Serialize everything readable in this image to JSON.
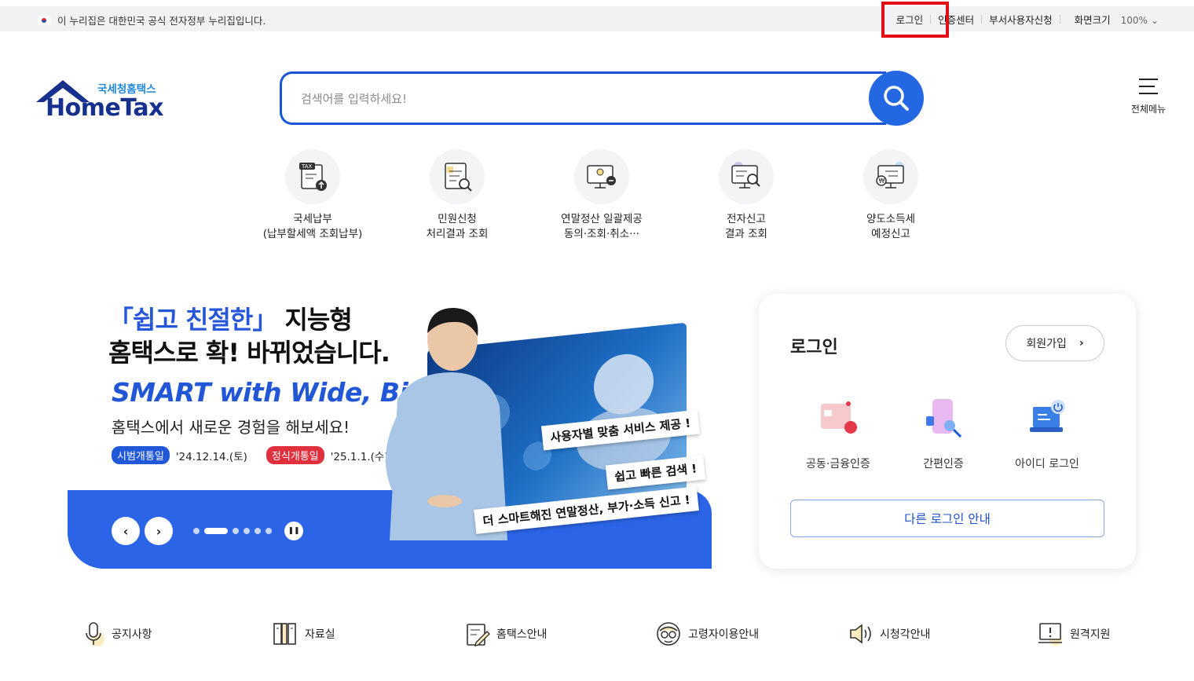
{
  "topbar": {
    "gov_notice": "이 누리집은 대한민국 공식 전자정부 누리집입니다.",
    "links": [
      "로그인",
      "인증센터",
      "부서사용자신청",
      "화면크기"
    ],
    "zoom": "100%"
  },
  "logo": {
    "sub": "국세청홈택스",
    "main": "HomeTax"
  },
  "search": {
    "placeholder": "검색어를 입력하세요!"
  },
  "menu_all": "전체메뉴",
  "quick_menu": [
    {
      "line1": "국세납부",
      "line2": "(납부할세액 조회납부)",
      "icon": "tax-payment-icon"
    },
    {
      "line1": "민원신청",
      "line2": "처리결과 조회",
      "icon": "document-search-icon"
    },
    {
      "line1": "연말정산 일괄제공",
      "line2": "동의·조회·취소···",
      "icon": "monitor-location-icon"
    },
    {
      "line1": "전자신고",
      "line2": "결과 조회",
      "icon": "monitor-search-icon"
    },
    {
      "line1": "양도소득세",
      "line2": "예정신고",
      "icon": "monitor-won-icon"
    }
  ],
  "banner": {
    "headline1_hl": "「쉽고 친절한」",
    "headline1_rest": " 지능형",
    "headline2": "홈택스로 확! 바뀌었습니다.",
    "smart": "SMART with Wide, Big",
    "desc": "홈택스에서 새로운 경험을 해보세요!",
    "badge1": "시범개통일",
    "date1": "'24.12.14.(토)",
    "badge2": "정식개통일",
    "date2": "'25.1.1.(수)",
    "tags": [
      "사용자별 맞춤 서비스 제공 !",
      "쉽고 빠른 검색 !",
      "더 스마트해진 연말정산, 부가·소득 신고 !"
    ]
  },
  "login_panel": {
    "title": "로그인",
    "join": "회원가입",
    "options": [
      "공동·금융인증",
      "간편인증",
      "아이디 로그인"
    ],
    "other": "다른 로그인 안내"
  },
  "bottom_links": [
    {
      "label": "공지사항",
      "icon": "microphone-icon"
    },
    {
      "label": "자료실",
      "icon": "bookshelf-icon"
    },
    {
      "label": "홈택스안내",
      "icon": "edit-note-icon"
    },
    {
      "label": "고령자이용안내",
      "icon": "senior-glasses-icon"
    },
    {
      "label": "시청각안내",
      "icon": "speaker-icon"
    },
    {
      "label": "원격지원",
      "icon": "remote-alert-icon"
    }
  ],
  "colors": {
    "brand_blue": "#2467e3",
    "highlight_red": "#e30d18"
  }
}
